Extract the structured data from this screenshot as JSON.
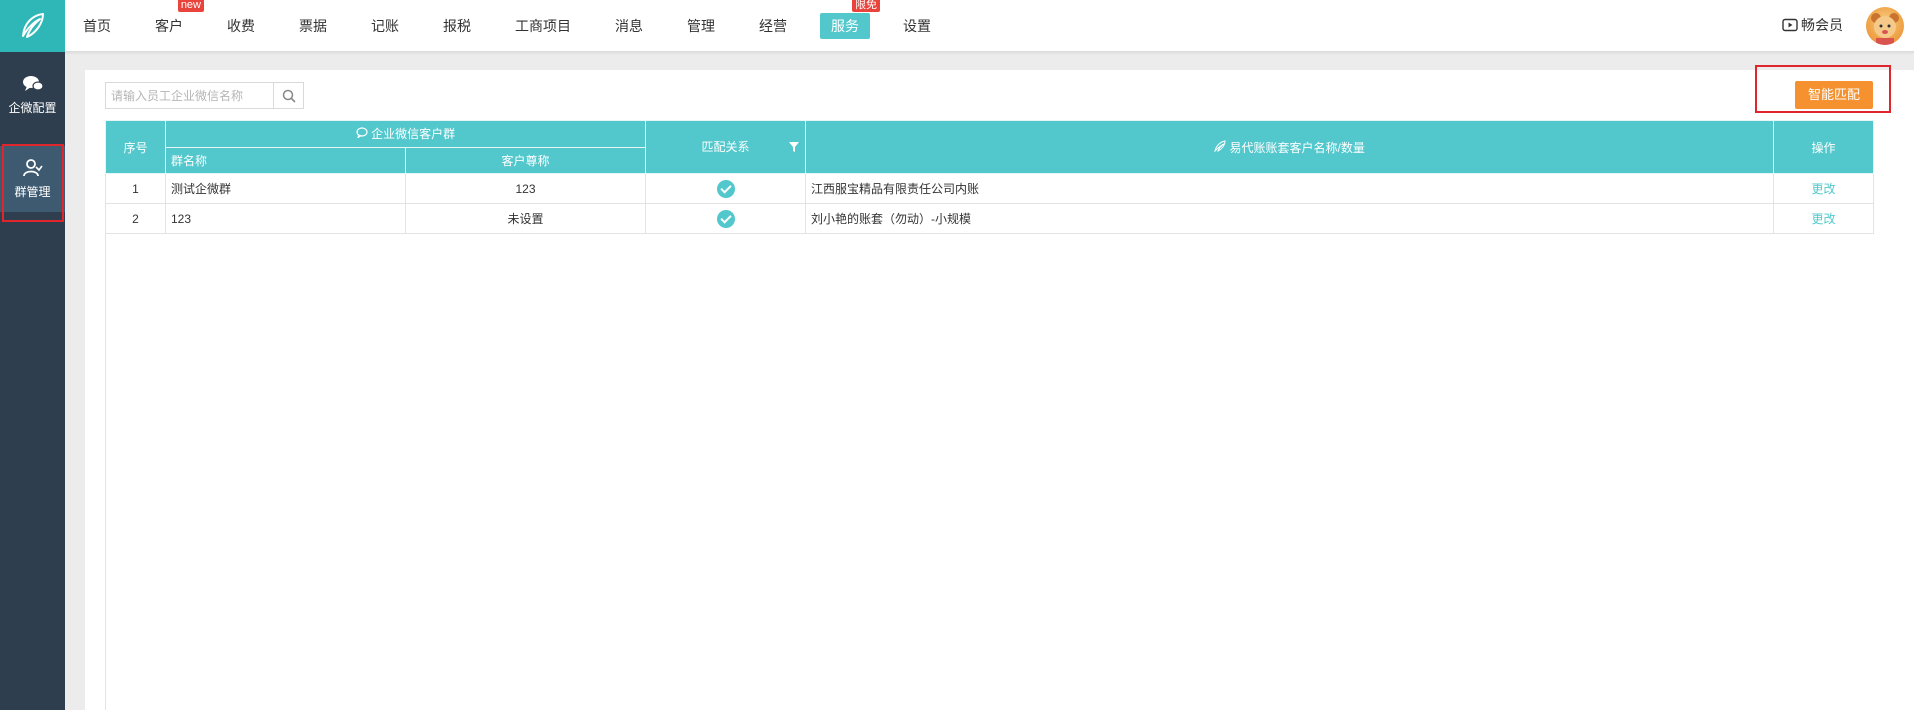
{
  "nav": [
    {
      "label": "首页",
      "name": "nav-home"
    },
    {
      "label": "客户",
      "name": "nav-customer",
      "badge": "new"
    },
    {
      "label": "收费",
      "name": "nav-charge"
    },
    {
      "label": "票据",
      "name": "nav-bills"
    },
    {
      "label": "记账",
      "name": "nav-bookkeeping"
    },
    {
      "label": "报税",
      "name": "nav-tax"
    },
    {
      "label": "工商项目",
      "name": "nav-business"
    },
    {
      "label": "消息",
      "name": "nav-messages"
    },
    {
      "label": "管理",
      "name": "nav-management"
    },
    {
      "label": "经营",
      "name": "nav-operation"
    },
    {
      "label": "服务",
      "name": "nav-service",
      "active": true,
      "badge": "限免"
    },
    {
      "label": "设置",
      "name": "nav-settings"
    }
  ],
  "vip_label": "畅会员",
  "sidebar": {
    "items": [
      {
        "label": "企微配置",
        "icon": "chat-bubbles-icon"
      },
      {
        "label": "群管理",
        "icon": "user-group-icon",
        "active": true
      }
    ]
  },
  "search": {
    "placeholder": "请输入员工企业微信名称"
  },
  "smart_match_label": "智能匹配",
  "table": {
    "headers": {
      "index": "序号",
      "group_title": "企业微信客户群",
      "group_name": "群名称",
      "customer_nick": "客户尊称",
      "match": "匹配关系",
      "account": "易代账账套客户名称/数量",
      "action": "操作"
    },
    "rows": [
      {
        "index": "1",
        "group_name": "测试企微群",
        "customer_nick": "123",
        "matched": true,
        "account": "江西服宝精品有限责任公司内账",
        "action": "更改"
      },
      {
        "index": "2",
        "group_name": "123",
        "customer_nick": "未设置",
        "matched": true,
        "account": "刘小艳的账套（勿动）-小规模",
        "action": "更改"
      }
    ]
  },
  "colors": {
    "accent": "#52c8cd",
    "orange": "#f5922f",
    "sidebar": "#2e3e4e",
    "highlight": "#e0262d"
  }
}
